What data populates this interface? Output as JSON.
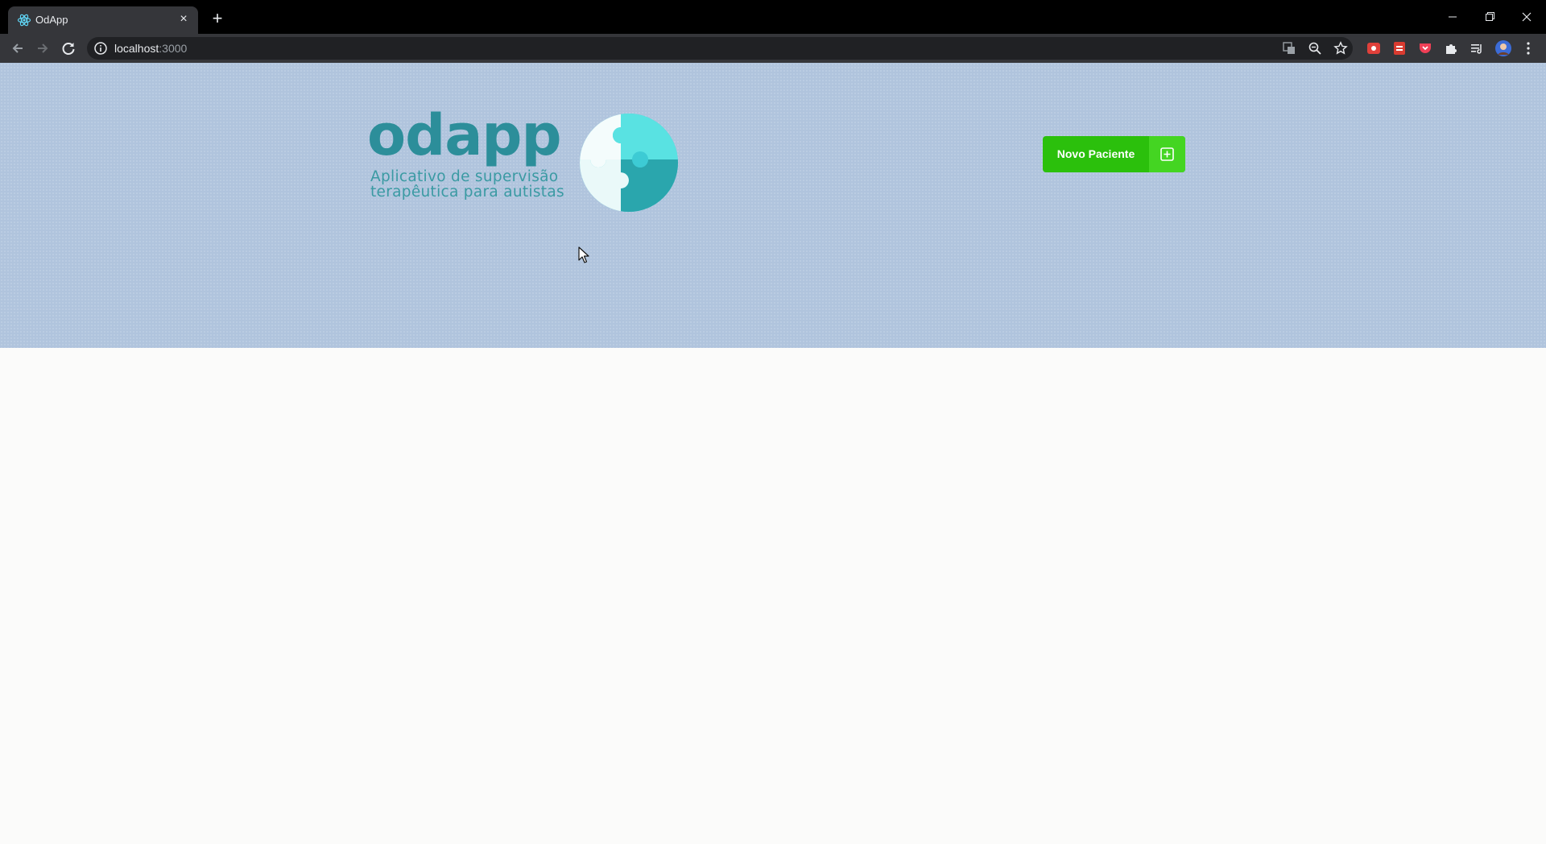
{
  "browser": {
    "tab": {
      "title": "OdApp",
      "close": "×"
    },
    "new_tab": "+",
    "window": {
      "minimize": "–",
      "restore": "❐",
      "close": "✕"
    },
    "address": {
      "host": "localhost",
      "port": ":3000"
    }
  },
  "page": {
    "logo": {
      "wordmark": "odapp",
      "tagline_line1": "Aplicativo de supervisão",
      "tagline_line2": "terapêutica para autistas"
    },
    "new_patient_button": {
      "label": "Novo Paciente",
      "icon": "plus-square-icon"
    }
  },
  "colors": {
    "hero_bg": "#b0c4dd",
    "brand_teal": "#2c8e9a",
    "button_green": "#2bc00c",
    "button_icon_green": "#44d522",
    "page_bg": "#fbfbfa"
  }
}
